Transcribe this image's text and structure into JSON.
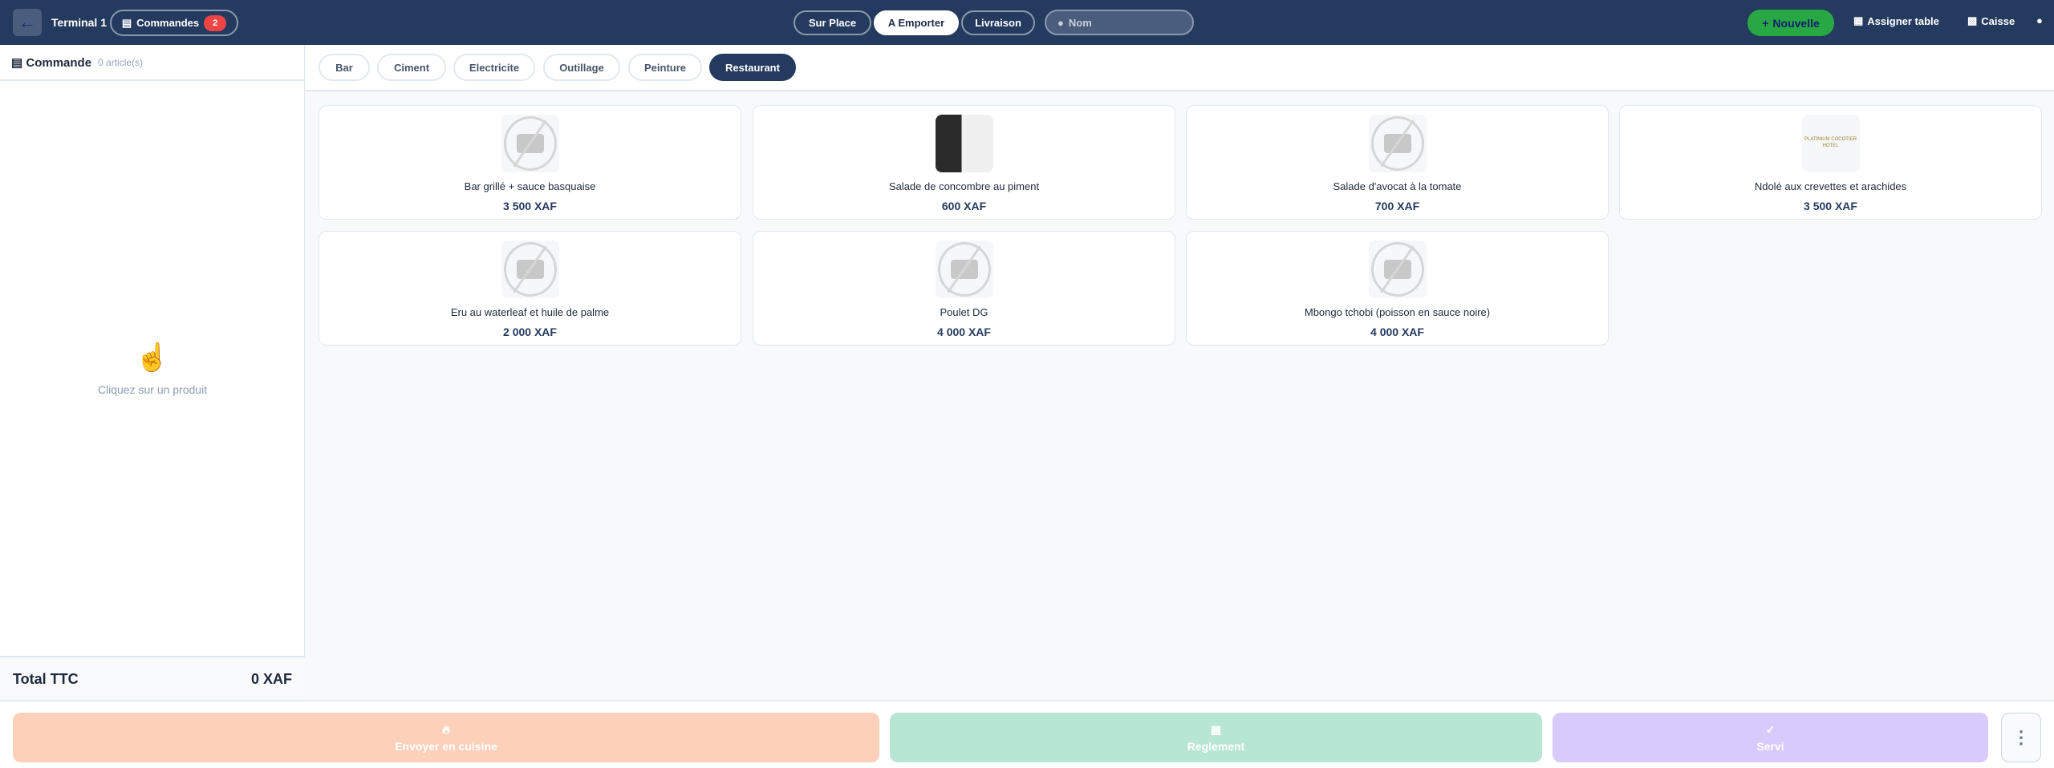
{
  "header": {
    "terminal": "Terminal 1",
    "orders_label": "Commandes",
    "orders_count": "2",
    "modes": [
      "Sur Place",
      "A Emporter",
      "Livraison"
    ],
    "active_mode": "A Emporter",
    "name_placeholder": "Nom",
    "new_label": "Nouvelle",
    "assign_label": "Assigner table",
    "cash_label": "Caisse"
  },
  "order": {
    "title": "Commande",
    "count": "0 article(s)",
    "empty_hint": "Cliquez sur un produit",
    "total_label": "Total TTC",
    "total_value": "0 XAF"
  },
  "categories": [
    "Bar",
    "Ciment",
    "Electricite",
    "Outillage",
    "Peinture",
    "Restaurant"
  ],
  "active_category": "Restaurant",
  "products": [
    {
      "name": "Bar grillé + sauce basquaise",
      "price": "3 500 XAF",
      "image": "no-image"
    },
    {
      "name": "Salade de concombre au piment",
      "price": "600 XAF",
      "image": "photo"
    },
    {
      "name": "Salade d'avocat à la tomate",
      "price": "700 XAF",
      "image": "no-image"
    },
    {
      "name": "Ndolé aux crevettes et arachides",
      "price": "3 500 XAF",
      "image": "logo",
      "logo_text": "PLATINIUM COCOTIER HOTEL"
    },
    {
      "name": "Eru au waterleaf et huile de palme",
      "price": "2 000 XAF",
      "image": "no-image"
    },
    {
      "name": "Poulet DG",
      "price": "4 000 XAF",
      "image": "no-image"
    },
    {
      "name": "Mbongo tchobi (poisson en sauce noire)",
      "price": "4 000 XAF",
      "image": "no-image"
    }
  ],
  "actions": {
    "send": "Envoyer en cuisine",
    "pay": "Reglement",
    "served": "Servi"
  },
  "colors": {
    "header": "#243a5e",
    "send": "#fcd0b9",
    "pay": "#b8e6d5",
    "served": "#d9cafc",
    "new": "#28a745",
    "badge": "#ef4444"
  }
}
